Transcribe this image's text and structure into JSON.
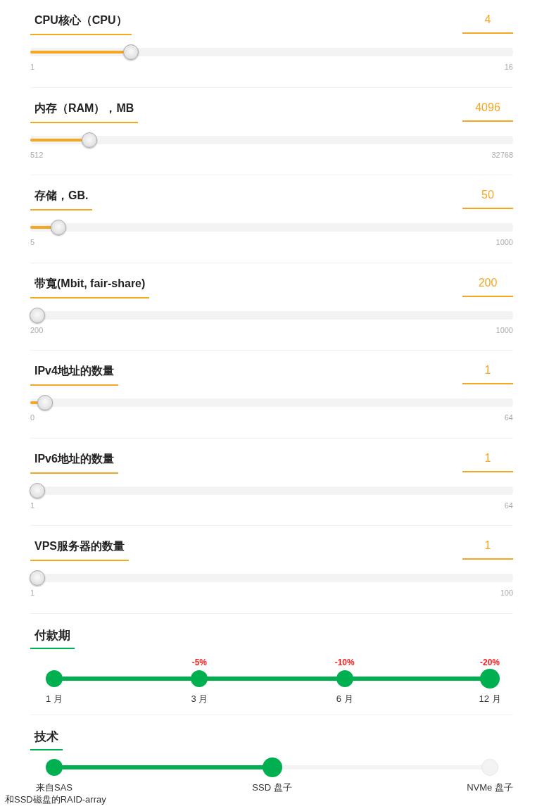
{
  "sliders": [
    {
      "label": "CPU核心（CPU）",
      "value": "4",
      "min": "1",
      "max": "16",
      "level": 0.2
    },
    {
      "label": "内存（RAM），MB",
      "value": "4096",
      "min": "512",
      "max": "32768",
      "level": 0.111
    },
    {
      "label": "存储，GB.",
      "value": "50",
      "min": "5",
      "max": "1000",
      "level": 0.045
    },
    {
      "label": "带寬(Mbit, fair-share)",
      "value": "200",
      "min": "200",
      "max": "1000",
      "level": 0
    },
    {
      "label": "IPv4地址的数量",
      "value": "1",
      "min": "0",
      "max": "64",
      "level": 0.016
    },
    {
      "label": "IPv6地址的数量",
      "value": "1",
      "min": "1",
      "max": "64",
      "level": 0
    },
    {
      "label": "VPS服务器的数量",
      "value": "1",
      "min": "1",
      "max": "100",
      "level": 0
    }
  ],
  "payment_period": {
    "title": "付款期",
    "steps": [
      {
        "label": "1 月",
        "selected": false
      },
      {
        "label": "3 月",
        "discount": "-5%",
        "selected": false
      },
      {
        "label": "6 月",
        "discount": "-10%",
        "selected": false
      },
      {
        "label": "12 月",
        "discount": "-20%",
        "selected": true
      }
    ]
  },
  "technology": {
    "title": "技术",
    "steps": [
      {
        "label": "来自SAS",
        "selected": false
      },
      {
        "label": "SSD 盘子",
        "selected": true
      },
      {
        "label": "NVMe 盘子",
        "selected": false
      }
    ],
    "note": "和SSD磁盘的RAID-array"
  }
}
